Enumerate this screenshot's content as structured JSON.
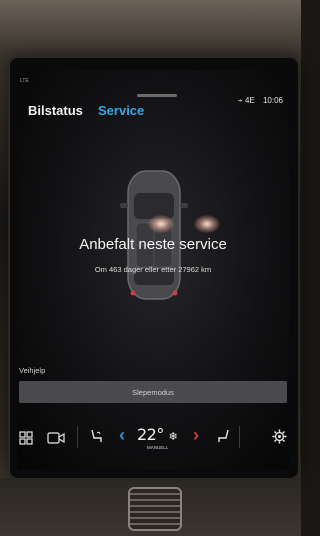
{
  "status_bar": {
    "left": "LTE",
    "icon_text": "⌁ 4E",
    "time": "10:06"
  },
  "tabs": [
    {
      "label": "Bilstatus",
      "active": false
    },
    {
      "label": "Service",
      "active": true
    }
  ],
  "service": {
    "headline": "Anbefalt neste service",
    "detail": "Om 463 dager eller etter 27962 km"
  },
  "assist": {
    "section_label": "Veihjelp",
    "tow_button_label": "Slepemodus"
  },
  "climate": {
    "temperature": "22°",
    "fan_icon_text": "❄",
    "mode_label": "MANUELL"
  },
  "icons": {
    "apps": "grid-icon",
    "camera": "camera-icon",
    "seat_heat_left": "seat-icon",
    "temp_down": "chevron-left-icon",
    "temp_up": "chevron-right-icon",
    "seat_heat_right": "seat-icon",
    "settings": "gear-icon"
  },
  "colors": {
    "accent_blue": "#35a9e8",
    "temp_down": "#2f8fd6",
    "temp_up": "#e0343f",
    "button_bg": "#4a4a4f"
  }
}
